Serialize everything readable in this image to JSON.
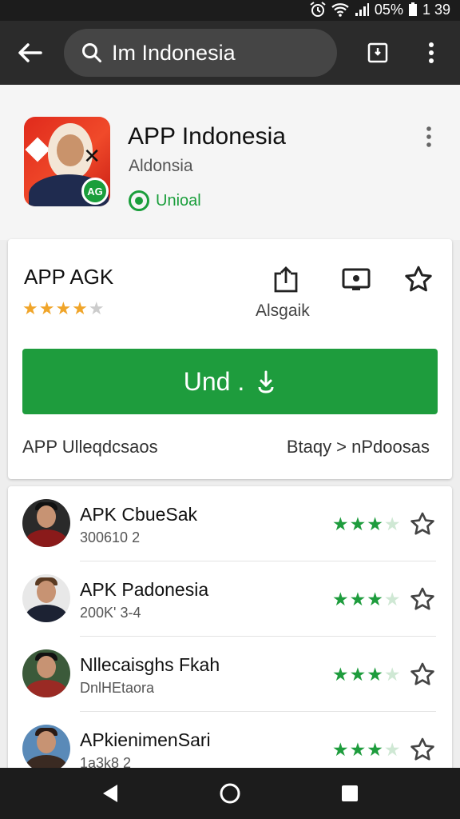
{
  "status_bar": {
    "battery": "05%",
    "time": "1 39"
  },
  "app_bar": {
    "search_query": "Im Indonesia"
  },
  "header": {
    "title": "APP Indonesia",
    "developer": "Aldonsia",
    "installed_label": "Unioal",
    "icon_badge": "AG"
  },
  "detail": {
    "name": "APP AGK",
    "rating_stars": 4,
    "rating_max": 5,
    "action_label": "Alsgaik",
    "install_label": "Und .",
    "footer_left": "APP Ulleqdcsaos",
    "footer_right": "Btaqy > nPdoosas"
  },
  "list": {
    "items": [
      {
        "name": "APK CbueSak",
        "sub": "300610 2",
        "stars": 3
      },
      {
        "name": "APK Padonesia",
        "sub": "200K' 3-4",
        "stars": 3
      },
      {
        "name": "Nllecaisghs Fkah",
        "sub": "DnlHEtaora",
        "stars": 3
      },
      {
        "name": "APkienimenSari",
        "sub": "1a3k8 2",
        "stars": 3
      }
    ]
  },
  "colors": {
    "accent_green": "#1e9c3d",
    "rating_orange": "#f0a52a",
    "app_bar": "#2b2b2b"
  },
  "icons": [
    "back-arrow-icon",
    "search-icon",
    "bookmark-icon",
    "more-vert-icon",
    "share-icon",
    "screenshot-icon",
    "star-icon",
    "play-icon",
    "home-icon",
    "recents-icon"
  ]
}
